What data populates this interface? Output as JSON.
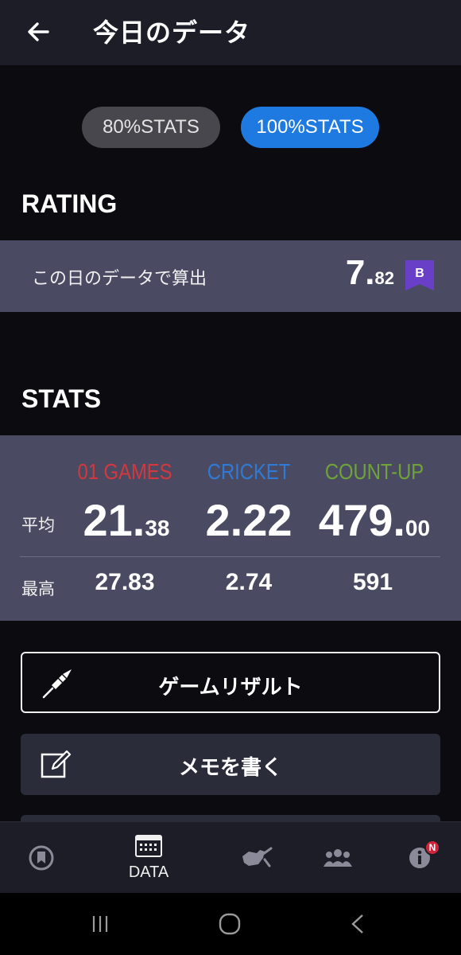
{
  "header": {
    "title": "今日のデータ",
    "back_icon": "arrow-left-icon"
  },
  "stats_toggle": {
    "option_80": "80%STATS",
    "option_100": "100%STATS",
    "selected": "100%STATS"
  },
  "rating": {
    "section_title": "RATING",
    "label": "この日のデータで算出",
    "value_int": "7.",
    "value_dec": "82",
    "rank": "B",
    "rank_color": "#6a3fc8"
  },
  "stats": {
    "section_title": "STATS",
    "columns": [
      {
        "name": "01 GAMES",
        "color": "#d2383e",
        "avg_int": "21.",
        "avg_dec": "38",
        "max": "27.83"
      },
      {
        "name": "CRICKET",
        "color": "#2f7ad6",
        "avg_int": "2.22",
        "avg_dec": "",
        "max": "2.74"
      },
      {
        "name": "COUNT-UP",
        "color": "#6fa33a",
        "avg_int": "479.",
        "avg_dec": "00",
        "max": "591"
      }
    ],
    "avg_label": "平均",
    "max_label": "最高"
  },
  "buttons": {
    "game_result": "ゲームリザルト",
    "memo": "メモを書く"
  },
  "bottom_nav": {
    "items": [
      {
        "label": "",
        "icon": "home-badge-icon"
      },
      {
        "label": "DATA",
        "icon": "calendar-icon"
      },
      {
        "label": "",
        "icon": "darts-hand-icon"
      },
      {
        "label": "",
        "icon": "friends-icon"
      },
      {
        "label": "",
        "icon": "info-icon",
        "badge": "N"
      }
    ],
    "active": "DATA"
  },
  "system_nav": {
    "icons": [
      "recent-apps-icon",
      "home-icon",
      "back-icon"
    ]
  }
}
